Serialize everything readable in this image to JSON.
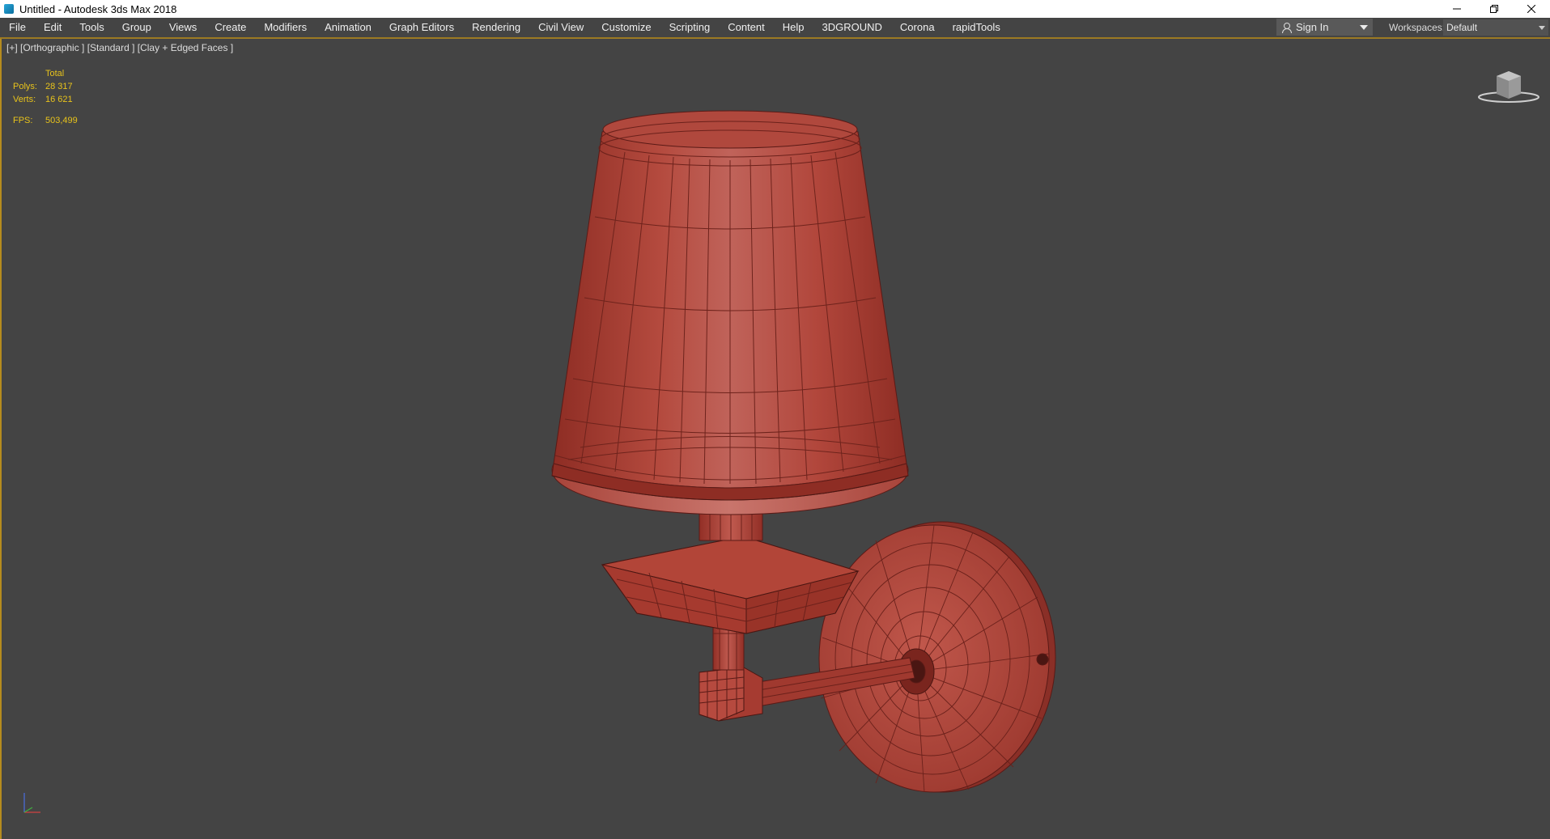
{
  "window": {
    "title": "Untitled - Autodesk 3ds Max 2018",
    "controls": [
      "minimize-icon",
      "restore-icon",
      "close-icon"
    ]
  },
  "menubar": {
    "items": [
      {
        "label": "File"
      },
      {
        "label": "Edit"
      },
      {
        "label": "Tools"
      },
      {
        "label": "Group"
      },
      {
        "label": "Views"
      },
      {
        "label": "Create"
      },
      {
        "label": "Modifiers"
      },
      {
        "label": "Animation"
      },
      {
        "label": "Graph Editors"
      },
      {
        "label": "Rendering"
      },
      {
        "label": "Civil View"
      },
      {
        "label": "Customize"
      },
      {
        "label": "Scripting"
      },
      {
        "label": "Content"
      },
      {
        "label": "Help"
      },
      {
        "label": "3DGROUND"
      },
      {
        "label": "Corona"
      },
      {
        "label": "rapidTools"
      }
    ],
    "signin_label": "Sign In",
    "workspaces_label": "Workspaces:",
    "workspace_value": "Default"
  },
  "viewport": {
    "label": "[+] [Orthographic ] [Standard ] [Clay + Edged Faces ]",
    "stats": {
      "header": "Total",
      "polys_label": "Polys:",
      "polys_value": "28 317",
      "verts_label": "Verts:",
      "verts_value": "16 621",
      "fps_label": "FPS:",
      "fps_value": "503,499"
    }
  },
  "colors": {
    "ui_bg": "#444444",
    "stats_text": "#e8c31b",
    "viewport_border": "#b58b1e",
    "model_red": "#b8453a",
    "model_edges": "#5a1a16"
  }
}
